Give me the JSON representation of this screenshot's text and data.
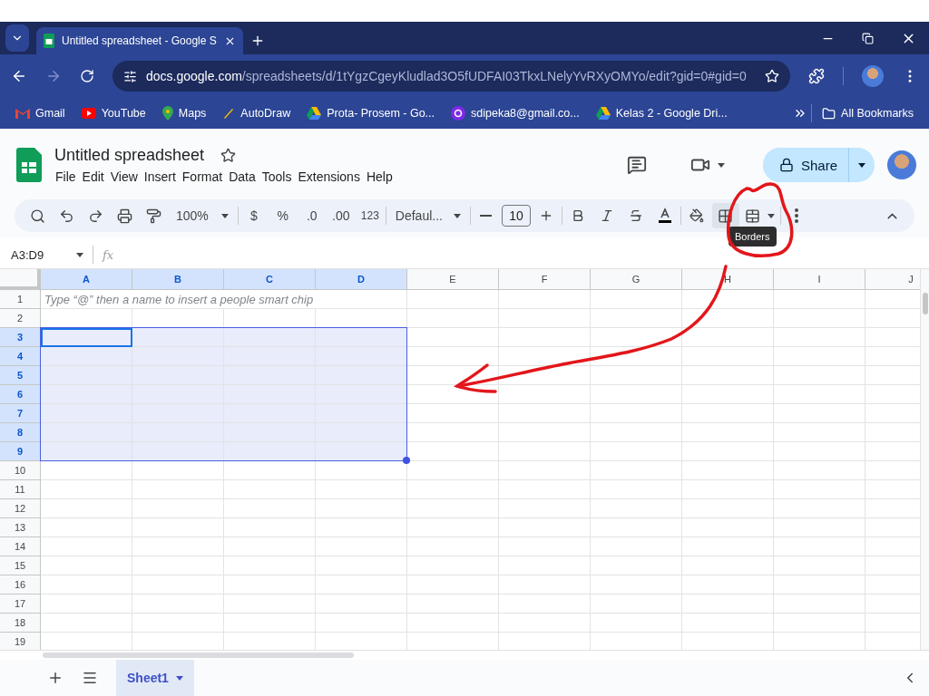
{
  "browser": {
    "tabs": [
      {
        "title": "Untitled spreadsheet - Google S",
        "selected": true
      }
    ],
    "url_host": "docs.google.com",
    "url_path": "/spreadsheets/d/1tYgzCgeyKludlad3O5fUDFAI03TkxLNelyYvRXyOMYo/edit?gid=0#gid=0",
    "bookmarks": [
      {
        "label": "Gmail",
        "kind": "gmail"
      },
      {
        "label": "YouTube",
        "kind": "youtube"
      },
      {
        "label": "Maps",
        "kind": "maps"
      },
      {
        "label": "AutoDraw",
        "kind": "autodraw"
      },
      {
        "label": "Prota- Prosem - Go...",
        "kind": "drive"
      },
      {
        "label": "sdipeka8@gmail.co...",
        "kind": "canva"
      },
      {
        "label": "Kelas 2 - Google Dri...",
        "kind": "drive"
      }
    ],
    "all_bookmarks": "All Bookmarks"
  },
  "doc": {
    "title": "Untitled spreadsheet",
    "menus": [
      "File",
      "Edit",
      "View",
      "Insert",
      "Format",
      "Data",
      "Tools",
      "Extensions",
      "Help"
    ],
    "share": "Share"
  },
  "toolbar": {
    "zoom": "100%",
    "currency": "$",
    "percent": "%",
    "decrease_decimal": ".0",
    "increase_decimal": ".00",
    "number_format": "123",
    "font": "Defaul...",
    "font_size": "10",
    "tooltip": "Borders"
  },
  "formula_bar": {
    "name_box": "A3:D9",
    "fx": "fx"
  },
  "columns": [
    {
      "label": "A",
      "selected": true
    },
    {
      "label": "B",
      "selected": true
    },
    {
      "label": "C",
      "selected": true
    },
    {
      "label": "D",
      "selected": true
    },
    {
      "label": "E",
      "selected": false
    },
    {
      "label": "F",
      "selected": false
    },
    {
      "label": "G",
      "selected": false
    },
    {
      "label": "H",
      "selected": false
    },
    {
      "label": "I",
      "selected": false
    },
    {
      "label": "J",
      "selected": false
    }
  ],
  "rows": [
    {
      "label": "1",
      "selected": false,
      "hint": "Type “@” then a name to insert a people smart chip"
    },
    {
      "label": "2",
      "selected": false
    },
    {
      "label": "3",
      "selected": true
    },
    {
      "label": "4",
      "selected": true
    },
    {
      "label": "5",
      "selected": true
    },
    {
      "label": "6",
      "selected": true
    },
    {
      "label": "7",
      "selected": true
    },
    {
      "label": "8",
      "selected": true
    },
    {
      "label": "9",
      "selected": true
    },
    {
      "label": "10",
      "selected": false
    },
    {
      "label": "11",
      "selected": false
    },
    {
      "label": "12",
      "selected": false
    },
    {
      "label": "13",
      "selected": false
    },
    {
      "label": "14",
      "selected": false
    },
    {
      "label": "15",
      "selected": false
    },
    {
      "label": "16",
      "selected": false
    },
    {
      "label": "17",
      "selected": false
    },
    {
      "label": "18",
      "selected": false
    },
    {
      "label": "19",
      "selected": false
    }
  ],
  "sheets": [
    {
      "label": "Sheet1",
      "selected": true
    }
  ]
}
